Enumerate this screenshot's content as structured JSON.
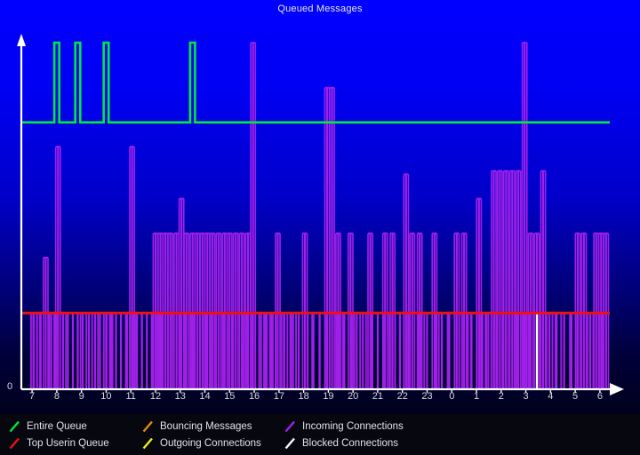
{
  "window": {
    "background_color": "#000000"
  },
  "chart_title": "Queued Messages",
  "axis": {
    "y_zero_label": "0",
    "axis_color": "#ffffff",
    "y_arrow": "up-arrow-icon",
    "x_arrow": "right-arrow-icon"
  },
  "legend": {
    "items": [
      {
        "label": "Entire Queue",
        "color": "#00e83c",
        "name": "legend-entire-queue"
      },
      {
        "label": "Top Userin Queue",
        "color": "#ee1111",
        "name": "legend-top-userin-queue"
      },
      {
        "label": "Bouncing Messages",
        "color": "#e08a10",
        "name": "legend-bouncing-messages"
      },
      {
        "label": "Outgoing Connections",
        "color": "#eeee22",
        "name": "legend-outgoing-connections"
      },
      {
        "label": "Incoming Connections",
        "color": "#a021e8",
        "name": "legend-incoming-connections"
      },
      {
        "label": "Blocked Connections",
        "color": "#ffffff",
        "name": "legend-blocked-connections"
      }
    ]
  },
  "chart_data": {
    "type": "line",
    "title": "Queued Messages",
    "xlabel": "",
    "ylabel": "",
    "grid": false,
    "legend_position": "bottom",
    "xlim": [
      6.6,
      30.4
    ],
    "ylim": [
      0,
      100
    ],
    "x_tick_labels": [
      "7",
      "8",
      "9",
      "10",
      "11",
      "12",
      "13",
      "14",
      "15",
      "16",
      "17",
      "18",
      "19",
      "20",
      "21",
      "22",
      "23",
      "0",
      "1",
      "2",
      "3",
      "4",
      "5",
      "6"
    ],
    "x_tick_hours": [
      7,
      8,
      9,
      10,
      11,
      12,
      13,
      14,
      15,
      16,
      17,
      18,
      19,
      20,
      21,
      22,
      23,
      24,
      25,
      26,
      27,
      28,
      29,
      30
    ],
    "y_tick_labels": [
      "0"
    ],
    "y_tick_values": [
      0
    ],
    "series": [
      {
        "name": "Entire Queue",
        "color": "#00e83c",
        "baseline": 77,
        "description": "Flat plateau near 77 with four narrow spikes to 100",
        "spikes": [
          {
            "x": 8.0,
            "value": 100
          },
          {
            "x": 8.85,
            "value": 100
          },
          {
            "x": 10.0,
            "value": 100
          },
          {
            "x": 13.5,
            "value": 100
          }
        ]
      },
      {
        "name": "Top Userin Queue",
        "color": "#ee1111",
        "baseline": 22,
        "description": "Constant flat line at 22 across the whole range",
        "spikes": []
      },
      {
        "name": "Bouncing Messages",
        "color": "#e08a10",
        "baseline": 0,
        "description": "Flat at zero, not visibly plotted above the axis",
        "spikes": []
      },
      {
        "name": "Outgoing Connections",
        "color": "#eeee22",
        "baseline": 0,
        "description": "Flat at zero, not visibly plotted above the axis",
        "spikes": []
      },
      {
        "name": "Incoming Connections",
        "color": "#a021e8",
        "baseline": 0,
        "description": "Dense square-wave bursts across the full 24h span; most pulses reach 22, many reach 38-55, a few reach 70-100",
        "pulses": [
          {
            "x": 7.05,
            "value": 22
          },
          {
            "x": 7.2,
            "value": 22
          },
          {
            "x": 7.35,
            "value": 22
          },
          {
            "x": 7.55,
            "value": 38
          },
          {
            "x": 7.7,
            "value": 22
          },
          {
            "x": 7.9,
            "value": 22
          },
          {
            "x": 8.05,
            "value": 70
          },
          {
            "x": 8.25,
            "value": 22
          },
          {
            "x": 8.45,
            "value": 22
          },
          {
            "x": 8.65,
            "value": 22
          },
          {
            "x": 8.85,
            "value": 22
          },
          {
            "x": 9.05,
            "value": 22
          },
          {
            "x": 9.3,
            "value": 22
          },
          {
            "x": 9.55,
            "value": 22
          },
          {
            "x": 9.75,
            "value": 22
          },
          {
            "x": 10.0,
            "value": 22
          },
          {
            "x": 10.2,
            "value": 22
          },
          {
            "x": 10.4,
            "value": 22
          },
          {
            "x": 10.6,
            "value": 22
          },
          {
            "x": 10.8,
            "value": 22
          },
          {
            "x": 11.05,
            "value": 70
          },
          {
            "x": 11.25,
            "value": 22
          },
          {
            "x": 11.45,
            "value": 22
          },
          {
            "x": 11.65,
            "value": 22
          },
          {
            "x": 11.85,
            "value": 22
          },
          {
            "x": 12.0,
            "value": 45
          },
          {
            "x": 12.2,
            "value": 45
          },
          {
            "x": 12.4,
            "value": 45
          },
          {
            "x": 12.6,
            "value": 45
          },
          {
            "x": 12.85,
            "value": 45
          },
          {
            "x": 13.05,
            "value": 55
          },
          {
            "x": 13.25,
            "value": 45
          },
          {
            "x": 13.5,
            "value": 45
          },
          {
            "x": 13.7,
            "value": 45
          },
          {
            "x": 13.9,
            "value": 45
          },
          {
            "x": 14.1,
            "value": 45
          },
          {
            "x": 14.3,
            "value": 45
          },
          {
            "x": 14.55,
            "value": 45
          },
          {
            "x": 14.8,
            "value": 45
          },
          {
            "x": 15.0,
            "value": 45
          },
          {
            "x": 15.25,
            "value": 45
          },
          {
            "x": 15.5,
            "value": 45
          },
          {
            "x": 15.75,
            "value": 45
          },
          {
            "x": 15.95,
            "value": 100
          },
          {
            "x": 16.2,
            "value": 22
          },
          {
            "x": 16.45,
            "value": 22
          },
          {
            "x": 16.7,
            "value": 22
          },
          {
            "x": 16.95,
            "value": 45
          },
          {
            "x": 17.2,
            "value": 22
          },
          {
            "x": 17.5,
            "value": 22
          },
          {
            "x": 17.8,
            "value": 22
          },
          {
            "x": 18.05,
            "value": 45
          },
          {
            "x": 18.35,
            "value": 22
          },
          {
            "x": 18.65,
            "value": 22
          },
          {
            "x": 18.95,
            "value": 87
          },
          {
            "x": 19.15,
            "value": 87
          },
          {
            "x": 19.4,
            "value": 45
          },
          {
            "x": 19.65,
            "value": 22
          },
          {
            "x": 19.9,
            "value": 45
          },
          {
            "x": 20.15,
            "value": 22
          },
          {
            "x": 20.4,
            "value": 22
          },
          {
            "x": 20.7,
            "value": 45
          },
          {
            "x": 21.0,
            "value": 22
          },
          {
            "x": 21.3,
            "value": 45
          },
          {
            "x": 21.6,
            "value": 45
          },
          {
            "x": 21.9,
            "value": 22
          },
          {
            "x": 22.15,
            "value": 62
          },
          {
            "x": 22.4,
            "value": 45
          },
          {
            "x": 22.7,
            "value": 45
          },
          {
            "x": 23.0,
            "value": 22
          },
          {
            "x": 23.3,
            "value": 45
          },
          {
            "x": 23.6,
            "value": 22
          },
          {
            "x": 23.9,
            "value": 22
          },
          {
            "x": 24.2,
            "value": 45
          },
          {
            "x": 24.5,
            "value": 45
          },
          {
            "x": 24.8,
            "value": 22
          },
          {
            "x": 25.1,
            "value": 55
          },
          {
            "x": 25.4,
            "value": 22
          },
          {
            "x": 25.7,
            "value": 63
          },
          {
            "x": 25.95,
            "value": 63
          },
          {
            "x": 26.2,
            "value": 63
          },
          {
            "x": 26.45,
            "value": 63
          },
          {
            "x": 26.7,
            "value": 63
          },
          {
            "x": 26.95,
            "value": 100
          },
          {
            "x": 27.2,
            "value": 45
          },
          {
            "x": 27.45,
            "value": 45
          },
          {
            "x": 27.7,
            "value": 63
          },
          {
            "x": 27.95,
            "value": 22
          },
          {
            "x": 28.25,
            "value": 22
          },
          {
            "x": 28.55,
            "value": 22
          },
          {
            "x": 28.85,
            "value": 22
          },
          {
            "x": 29.1,
            "value": 45
          },
          {
            "x": 29.35,
            "value": 45
          },
          {
            "x": 29.6,
            "value": 22
          },
          {
            "x": 29.85,
            "value": 45
          },
          {
            "x": 30.05,
            "value": 45
          },
          {
            "x": 30.25,
            "value": 45
          }
        ]
      },
      {
        "name": "Blocked Connections",
        "color": "#ffffff",
        "baseline": 0,
        "description": "Single narrow spike to 22 just after hour 3",
        "spikes": [
          {
            "x": 27.45,
            "value": 22
          }
        ]
      }
    ]
  }
}
